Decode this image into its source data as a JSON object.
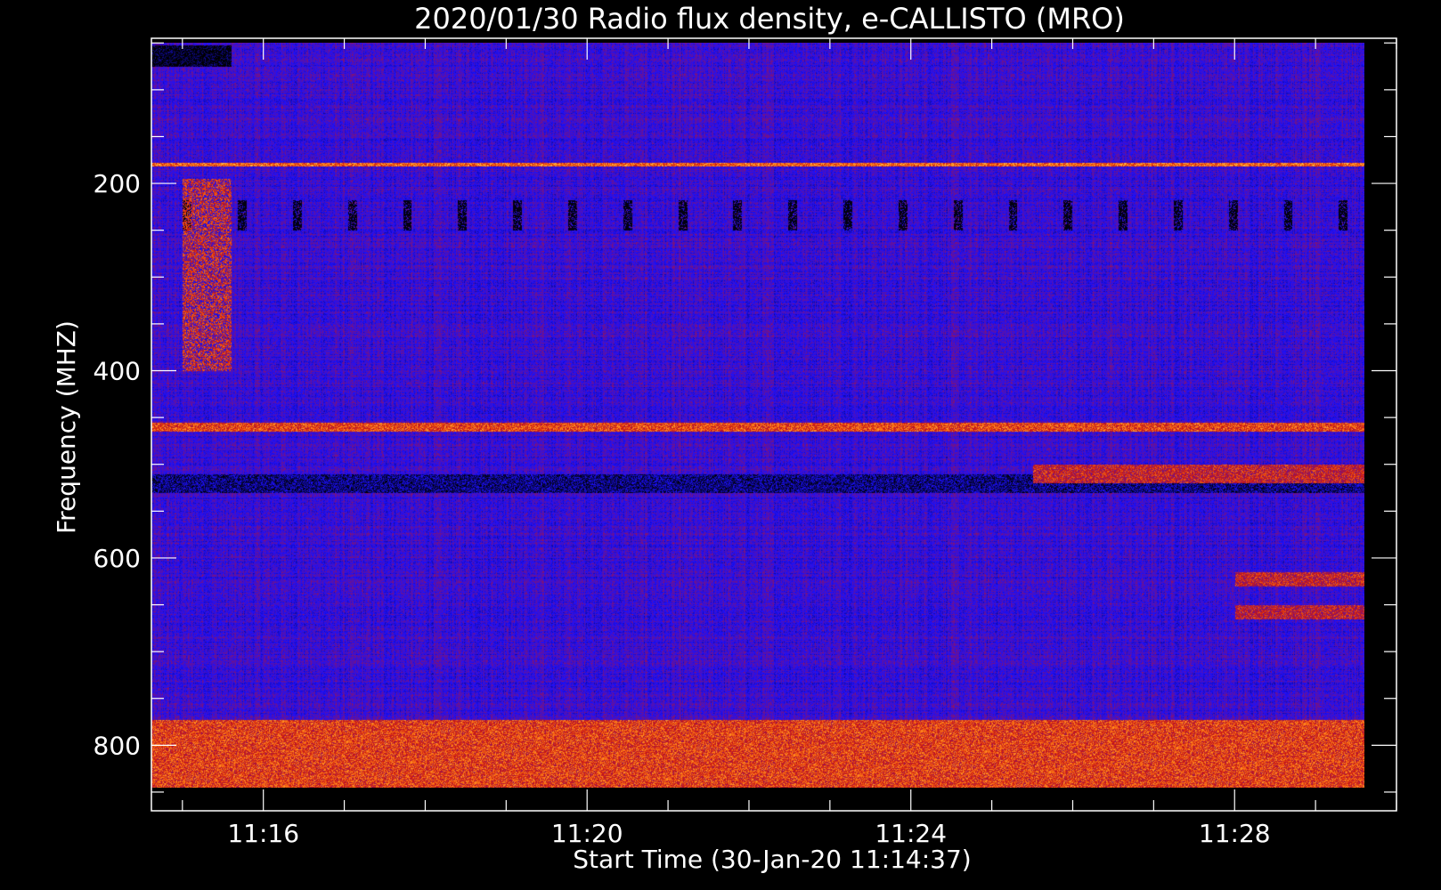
{
  "chart_data": {
    "type": "heatmap",
    "title": "2020/01/30  Radio flux density, e-CALLISTO (MRO)",
    "xlabel": "Start Time (30-Jan-20 11:14:37)",
    "ylabel": "Frequency (MHZ)",
    "x_ticks": [
      "11:16",
      "11:20",
      "11:24",
      "11:28"
    ],
    "x_tick_values_min": [
      16,
      20,
      24,
      28
    ],
    "x_range_min": [
      14.617,
      30.0
    ],
    "y_ticks": [
      "200",
      "400",
      "600",
      "800"
    ],
    "y_tick_values": [
      200,
      400,
      600,
      800
    ],
    "y_range": [
      45,
      870
    ],
    "data_range": {
      "freq": [
        50,
        845
      ],
      "time_min": [
        14.617,
        29.6
      ]
    },
    "colormap": [
      "#000000",
      "#1a10ff",
      "#c81414",
      "#ff7a14",
      "#ffe060"
    ],
    "background_level": 0.35,
    "horizontal_bands": [
      {
        "freq": [
          52,
          75
        ],
        "time_min": [
          14.617,
          15.6
        ],
        "level": 0.02
      },
      {
        "freq": [
          178,
          182
        ],
        "level": 0.78
      },
      {
        "freq": [
          455,
          465
        ],
        "level": 0.72
      },
      {
        "freq": [
          510,
          530
        ],
        "level": 0.15
      },
      {
        "freq": [
          500,
          520
        ],
        "time_min": [
          25.5,
          29.6
        ],
        "level": 0.62
      },
      {
        "freq": [
          615,
          630
        ],
        "time_min": [
          28.0,
          29.6
        ],
        "level": 0.62
      },
      {
        "freq": [
          650,
          665
        ],
        "time_min": [
          28.0,
          29.6
        ],
        "level": 0.6
      },
      {
        "freq": [
          772,
          845
        ],
        "level": 0.7
      }
    ],
    "dark_bursts": {
      "freq": [
        218,
        250
      ],
      "period_min": 0.68,
      "start_min": 15.0,
      "end_min": 29.6,
      "level": 0.02
    },
    "bright_patch": {
      "freq": [
        195,
        400
      ],
      "time_min": [
        15.0,
        15.6
      ],
      "level": 0.7
    }
  }
}
